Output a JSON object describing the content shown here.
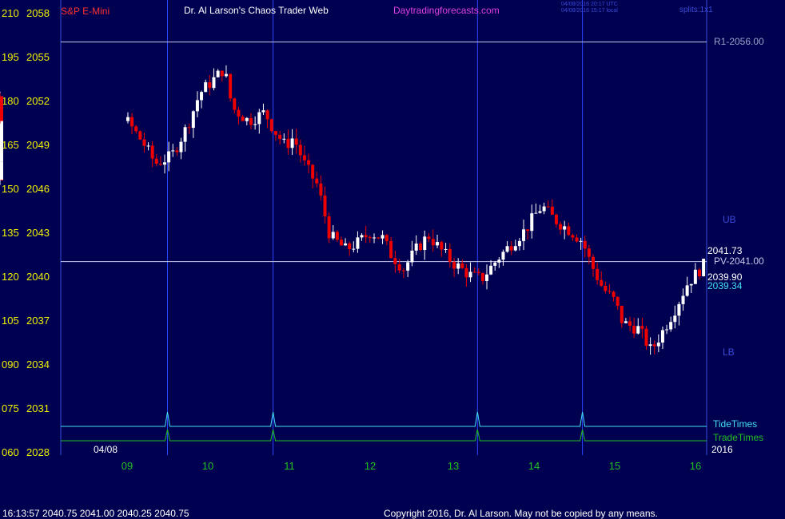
{
  "header": {
    "symbol": "S&P E-Mini",
    "title": "Dr. Al Larson's Chaos Trader Web",
    "site": "Daytradingforecasts.com",
    "timestamp_utc": "04/08/2016 20:17 UTC",
    "timestamp_local": "04/08/2016 15:17 local",
    "splits": "splits:1x1"
  },
  "footer": {
    "quote": "16:13:57  2040.75 2041.00 2040.25 2040.75",
    "copyright": "Copyright 2016, Dr. Al Larson. May not be copied by any means."
  },
  "chart_data": {
    "type": "candlestick",
    "y_left_ticks": [
      "210",
      "195",
      "180",
      "165",
      "150",
      "135",
      "120",
      "105",
      "090",
      "075",
      "060"
    ],
    "y_price_ticks": [
      2058,
      2055,
      2052,
      2049,
      2046,
      2043,
      2040,
      2037,
      2034,
      2031,
      2028
    ],
    "x_ticks": [
      "09",
      "10",
      "11",
      "12",
      "13",
      "14",
      "15",
      "16"
    ],
    "x_start_label": "04/08",
    "x_end_label": "2016",
    "ylim": [
      2028,
      2058
    ],
    "levels": [
      {
        "name": "R1",
        "label": "R1-2056.00",
        "value": 2056.0,
        "color": "#c8c8e8"
      },
      {
        "name": "PV",
        "label": "PV-2041.00",
        "value": 2041.0,
        "color": "#c8c8e8"
      }
    ],
    "right_values": [
      {
        "label": "2041.73",
        "value": 2041.73,
        "color": "#ffffff"
      },
      {
        "label": "2039.90",
        "value": 2039.9,
        "color": "#ffffff"
      },
      {
        "label": "2039.34",
        "value": 2039.34,
        "color": "#40e0f0"
      }
    ],
    "band_labels": {
      "upper": "UB",
      "lower": "LB"
    },
    "time_lines": {
      "tide_label": "TideTimes",
      "trade_label": "TradeTimes",
      "times": [
        9.5,
        10.8,
        13.3,
        14.6
      ]
    },
    "candles_sample": {
      "open_time": "08:15",
      "close_time": "16:15",
      "first_close": 2046.5,
      "high": 2055.3,
      "low": 2033.8,
      "last_close": 2040.75
    },
    "colors": {
      "bull": "#ffffff",
      "bear": "#ee0000",
      "ema_fast": "#ffff40",
      "ema_mid": "#40e0f0",
      "ema_slow": "#ffffc0",
      "band": "#2040e0"
    }
  }
}
